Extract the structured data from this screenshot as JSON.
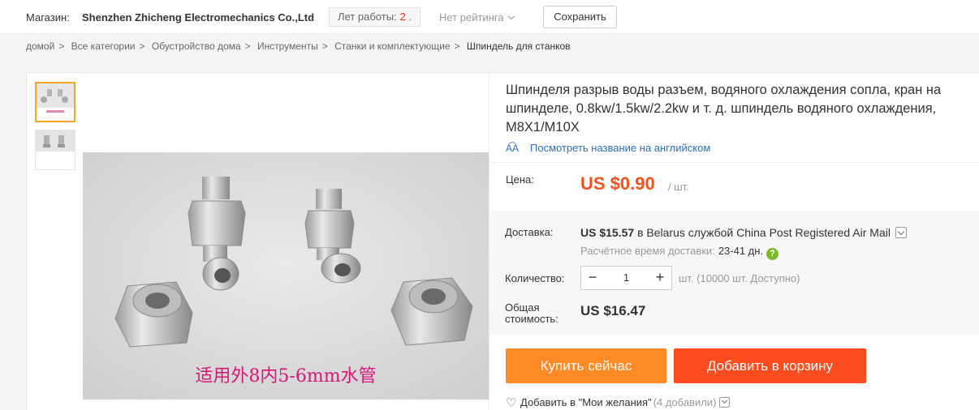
{
  "store": {
    "label": "Магазин:",
    "name": "Shenzhen Zhicheng Electromechanics Co.,Ltd",
    "years_label": "Лет работы:",
    "years_value": "2 .",
    "rating": "Нет рейтинга",
    "save_label": "Сохранить"
  },
  "breadcrumb": [
    "домой",
    "Все категории",
    "Обустройство дома",
    "Инструменты",
    "Станки и комплектующие",
    "Шпиндель для станков"
  ],
  "product": {
    "title": "Шпинделя разрыв воды разъем, водяного охлаждения сопла, кран на шпинделе, 0.8kw/1.5kw/2.2kw и т. д. шпиндель водяного охлаждения, M8X1/M10X",
    "translate_link": "Посмотреть название на английском",
    "image_caption": "适用外8内5-6mm水管"
  },
  "price": {
    "label": "Цена:",
    "value": "US $0.90",
    "unit": "/ шт."
  },
  "shipping": {
    "label": "Доставка:",
    "cost": "US $15.57",
    "description": "в Belarus службой China Post Registered Air Mail",
    "time_label": "Расчётное время доставки:",
    "time_value": "23-41 дн."
  },
  "quantity": {
    "label": "Количество:",
    "value": "1",
    "availability": "шт. (10000 шт. Доступно)"
  },
  "total": {
    "label_line1": "Общая",
    "label_line2": "стоимость:",
    "value": "US $16.47"
  },
  "actions": {
    "buy_now": "Купить сейчас",
    "add_to_cart": "Добавить в корзину",
    "wishlist": "Добавить в \"Мои желания\"",
    "wishlist_count": "(4 добавили)"
  },
  "colors": {
    "price": "#f4511e",
    "buy_button": "#fe8a25",
    "cart_button": "#fa4c1f",
    "link": "#2d6cc0",
    "help_icon": "#7cba2c"
  },
  "icons": [
    "translate-icon",
    "help-icon",
    "minus-icon",
    "plus-icon",
    "heart-icon",
    "chevron-down-icon"
  ]
}
